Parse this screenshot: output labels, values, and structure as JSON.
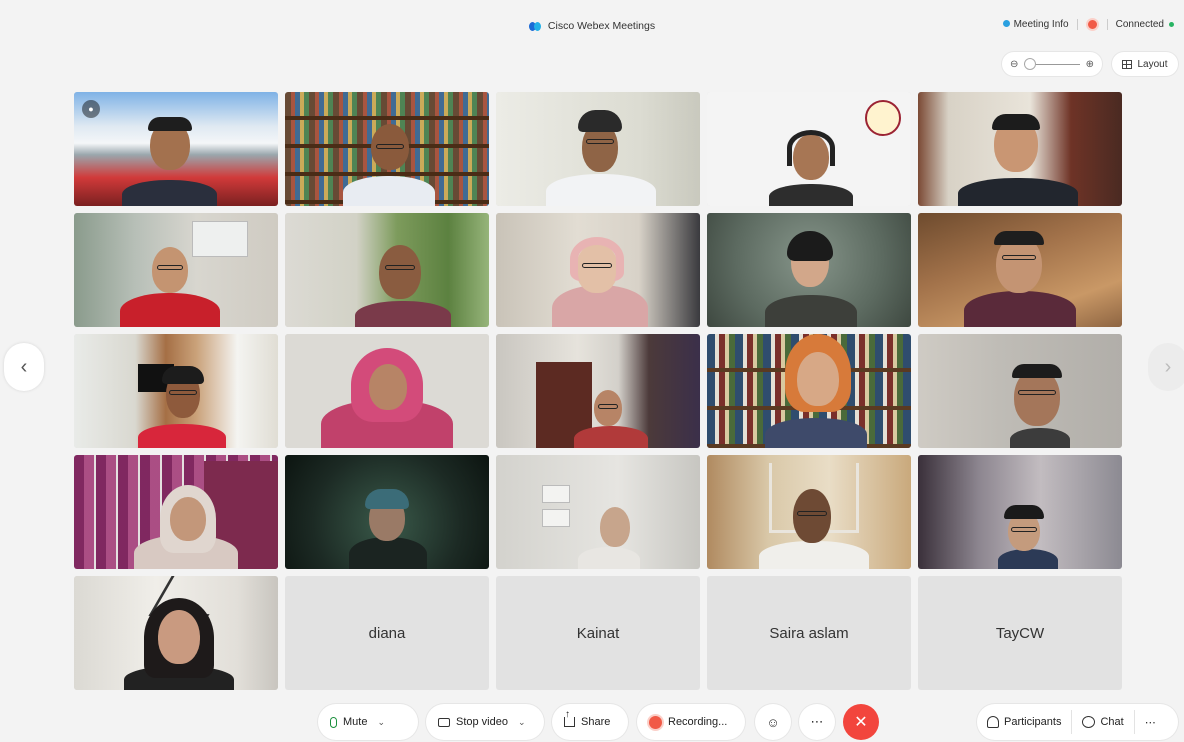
{
  "app": {
    "title": "Cisco Webex Meetings",
    "meeting_info_label": "Meeting Info",
    "connection_status": "Connected"
  },
  "view_controls": {
    "layout_label": "Layout",
    "zoom_out_icon": "zoom-out-icon",
    "zoom_in_icon": "zoom-in-icon",
    "zoom_level": 0.05
  },
  "participants_grid": {
    "rows": 5,
    "columns": 5,
    "name_only_tiles": [
      "diana",
      "Kainat",
      "Saira aslam",
      "TayCW"
    ]
  },
  "toolbar": {
    "mute_label": "Mute",
    "stop_video_label": "Stop video",
    "share_label": "Share",
    "recording_label": "Recording...",
    "more_label": "⋯",
    "end_label": "✕",
    "participants_label": "Participants",
    "chat_label": "Chat",
    "overflow_label": "⋯"
  },
  "colors": {
    "accent_green": "#1a8f3c",
    "recording_red": "#f15a47",
    "end_call_red": "#f2453d",
    "webex_blue": "#1b6ad6"
  }
}
